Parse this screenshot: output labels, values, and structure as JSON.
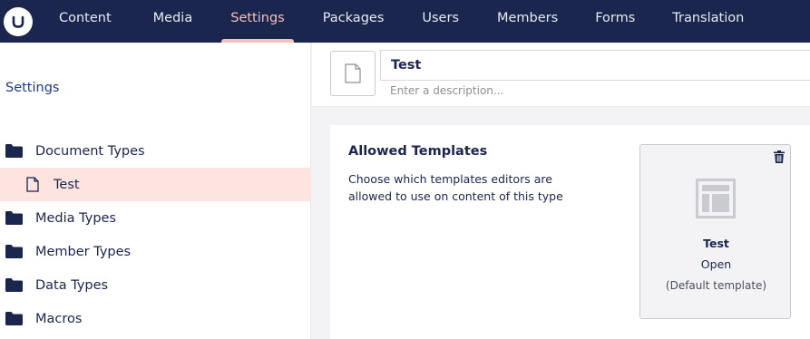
{
  "nav": {
    "items": [
      {
        "label": "Content"
      },
      {
        "label": "Media"
      },
      {
        "label": "Settings",
        "active": true
      },
      {
        "label": "Packages"
      },
      {
        "label": "Users"
      },
      {
        "label": "Members"
      },
      {
        "label": "Forms"
      },
      {
        "label": "Translation"
      }
    ]
  },
  "sidebar": {
    "title": "Settings",
    "items": [
      {
        "label": "Document Types",
        "icon": "folder-icon"
      },
      {
        "label": "Test",
        "icon": "document-icon",
        "selected": true
      },
      {
        "label": "Media Types",
        "icon": "folder-icon"
      },
      {
        "label": "Member Types",
        "icon": "folder-icon"
      },
      {
        "label": "Data Types",
        "icon": "folder-icon"
      },
      {
        "label": "Macros",
        "icon": "folder-icon"
      }
    ]
  },
  "header": {
    "name_value": "Test",
    "description_placeholder": "Enter a description..."
  },
  "allowed_templates": {
    "title": "Allowed Templates",
    "description": "Choose which templates editors are allowed to use on content of this type",
    "template": {
      "name": "Test",
      "open_label": "Open",
      "default_label": "(Default template)"
    }
  },
  "colors": {
    "topbar": "#1b264f",
    "accent": "#f5c1bc",
    "selected_row": "#fde4e1",
    "panel_bg": "#f3f3f5"
  }
}
